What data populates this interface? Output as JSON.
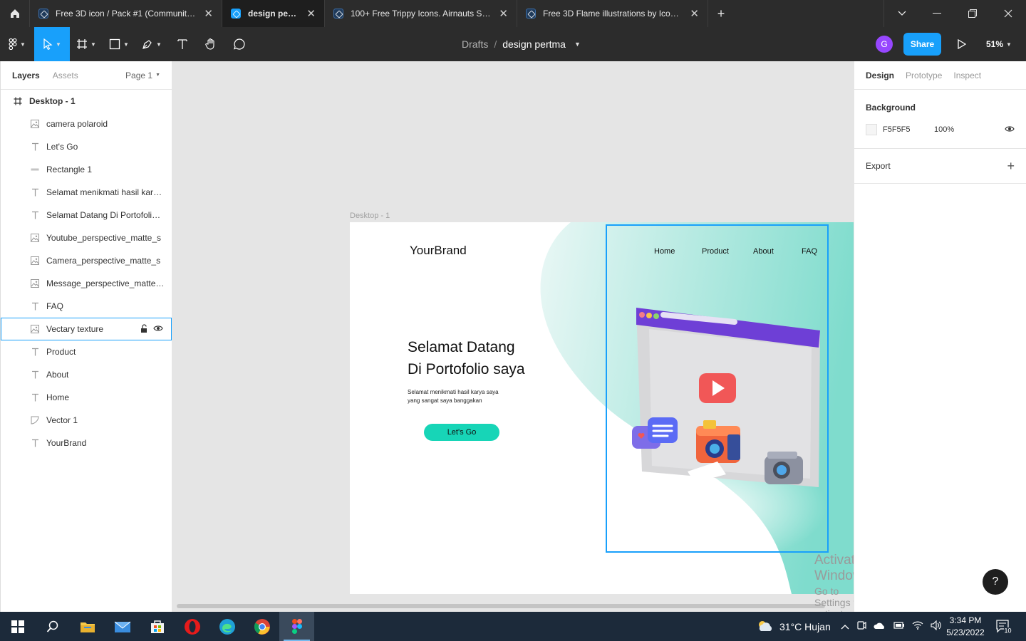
{
  "tabs": [
    {
      "title": "Free 3D icon / Pack #1 (Community)...",
      "active": false
    },
    {
      "title": "design pertma",
      "active": true
    },
    {
      "title": "100+ Free Trippy Icons. Airnauts Stu...",
      "active": false
    },
    {
      "title": "Free 3D Flame illustrations by Icons...",
      "active": false
    }
  ],
  "toolbar": {
    "breadcrumb_parent": "Drafts",
    "breadcrumb_sep": "/",
    "file_name": "design pertma",
    "avatar_initial": "G",
    "share_label": "Share",
    "zoom": "51%"
  },
  "left_panel": {
    "tab_layers": "Layers",
    "tab_assets": "Assets",
    "page": "Page 1",
    "frame_name": "Desktop - 1",
    "layers": [
      {
        "name": "camera polaroid",
        "type": "image"
      },
      {
        "name": "Let's Go",
        "type": "text"
      },
      {
        "name": "Rectangle 1",
        "type": "rect"
      },
      {
        "name": "Selamat menikmati hasil karya saya yang sangat saya banggakan",
        "type": "text"
      },
      {
        "name": "Selamat Datang Di Portofolio saya",
        "type": "text"
      },
      {
        "name": "Youtube_perspective_matte_s",
        "type": "image"
      },
      {
        "name": "Camera_perspective_matte_s",
        "type": "image"
      },
      {
        "name": "Message_perspective_matte_s",
        "type": "image"
      },
      {
        "name": "FAQ",
        "type": "text"
      },
      {
        "name": "Vectary texture",
        "type": "image"
      },
      {
        "name": "Product",
        "type": "text"
      },
      {
        "name": "About",
        "type": "text"
      },
      {
        "name": "Home",
        "type": "text"
      },
      {
        "name": "Vector 1",
        "type": "vector"
      },
      {
        "name": "YourBrand",
        "type": "text"
      }
    ]
  },
  "canvas": {
    "frame_label": "Desktop - 1",
    "brand": "YourBrand",
    "nav": [
      "Home",
      "Product",
      "About",
      "FAQ"
    ],
    "hero_title_1": "Selamat Datang",
    "hero_title_2": "Di Portofolio saya",
    "hero_sub_1": "Selamat menikmati hasil karya saya",
    "hero_sub_2": "yang sangat saya banggakan",
    "cta": "Let's Go",
    "accent_color": "#17d5b7",
    "activate_title": "Activate Windows",
    "activate_sub": "Go to Settings to activate Windows."
  },
  "right_panel": {
    "tab_design": "Design",
    "tab_prototype": "Prototype",
    "tab_inspect": "Inspect",
    "background_title": "Background",
    "bg_hex": "F5F5F5",
    "bg_opacity": "100%",
    "export_title": "Export"
  },
  "taskbar": {
    "weather": "31°C  Hujan",
    "time": "3:34 PM",
    "date": "5/23/2022",
    "notif_count": "10"
  }
}
